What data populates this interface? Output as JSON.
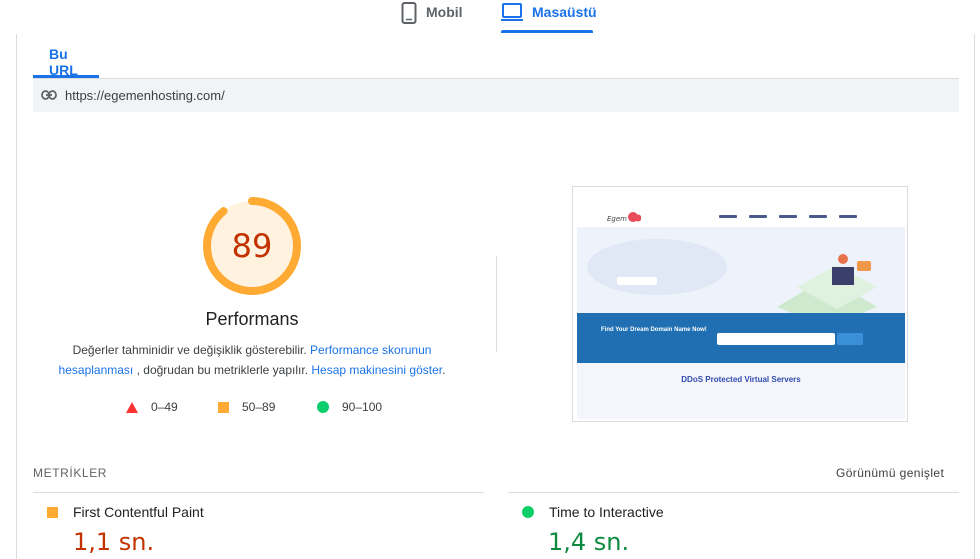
{
  "device_tabs": [
    {
      "label": "Mobil",
      "icon": "phone-icon",
      "active": false
    },
    {
      "label": "Masaüstü",
      "icon": "laptop-icon",
      "active": true
    }
  ],
  "url_tab": {
    "label": "Bu URL"
  },
  "url_bar": {
    "icon": "link-icon",
    "url": "https://egemenhosting.com/"
  },
  "performance": {
    "score": "89",
    "score_fraction": 0.89,
    "title": "Performans",
    "desc_1": "Değerler tahminidir ve değişiklik gösterebilir. ",
    "link_1": "Performance skorunun hesaplanması",
    "desc_2": " , doğrudan bu metriklerle yapılır. ",
    "link_2": "Hesap makinesini göster",
    "desc_3": ".",
    "colors": {
      "average": "#ffaa33",
      "average_bg": "#fff3e0",
      "average_text": "#c33300"
    }
  },
  "legend": [
    {
      "range": "0–49",
      "icon": "triangle-fail-icon",
      "color": "#ff3333"
    },
    {
      "range": "50–89",
      "icon": "square-average-icon",
      "color": "#ffaa33"
    },
    {
      "range": "90–100",
      "icon": "circle-pass-icon",
      "color": "#0cce6b"
    }
  ],
  "thumbnail": {
    "band_title": "Find Your Dream Domain Name Now!",
    "lower_title": "DDoS Protected Virtual Servers"
  },
  "metrics": {
    "heading": "METRİKLER",
    "expand_label": "Görünümü genişlet",
    "items": [
      {
        "label": "First Contentful Paint",
        "value": "1,1 sn.",
        "status": "average",
        "color": "#c33300"
      },
      {
        "label": "Time to Interactive",
        "value": "1,4 sn.",
        "status": "pass",
        "color": "#0d8a3f"
      }
    ]
  }
}
